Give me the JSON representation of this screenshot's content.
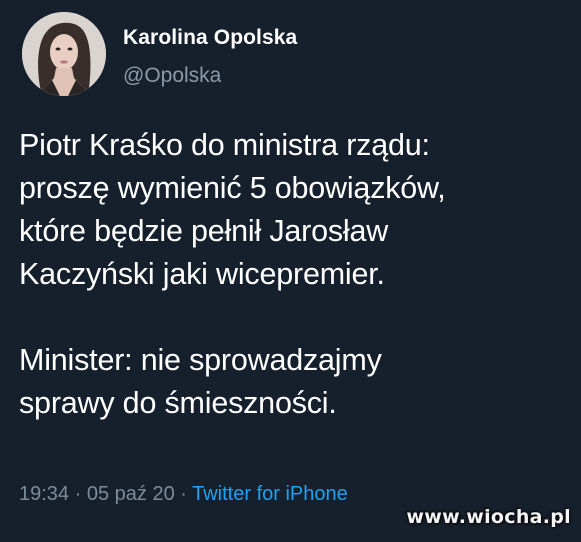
{
  "author": {
    "name": "Karolina Opolska",
    "handle": "@Opolska"
  },
  "tweet": {
    "text": "Piotr Kraśko do ministra rządu:\nproszę wymienić 5 obowiązków,\nktóre będzie pełnił Jarosław\nKaczyński jaki wicepremier.\n\nMinister: nie sprowadzajmy\nsprawy do śmieszności.",
    "time": "19:34",
    "separator": " · ",
    "date": "05 paź 20",
    "source": "Twitter for iPhone"
  },
  "watermark": "www.wiocha.pl",
  "colors": {
    "background": "#16202c",
    "text": "#ffffff",
    "secondary_text": "#8c9aa8",
    "link": "#1da1f2"
  }
}
